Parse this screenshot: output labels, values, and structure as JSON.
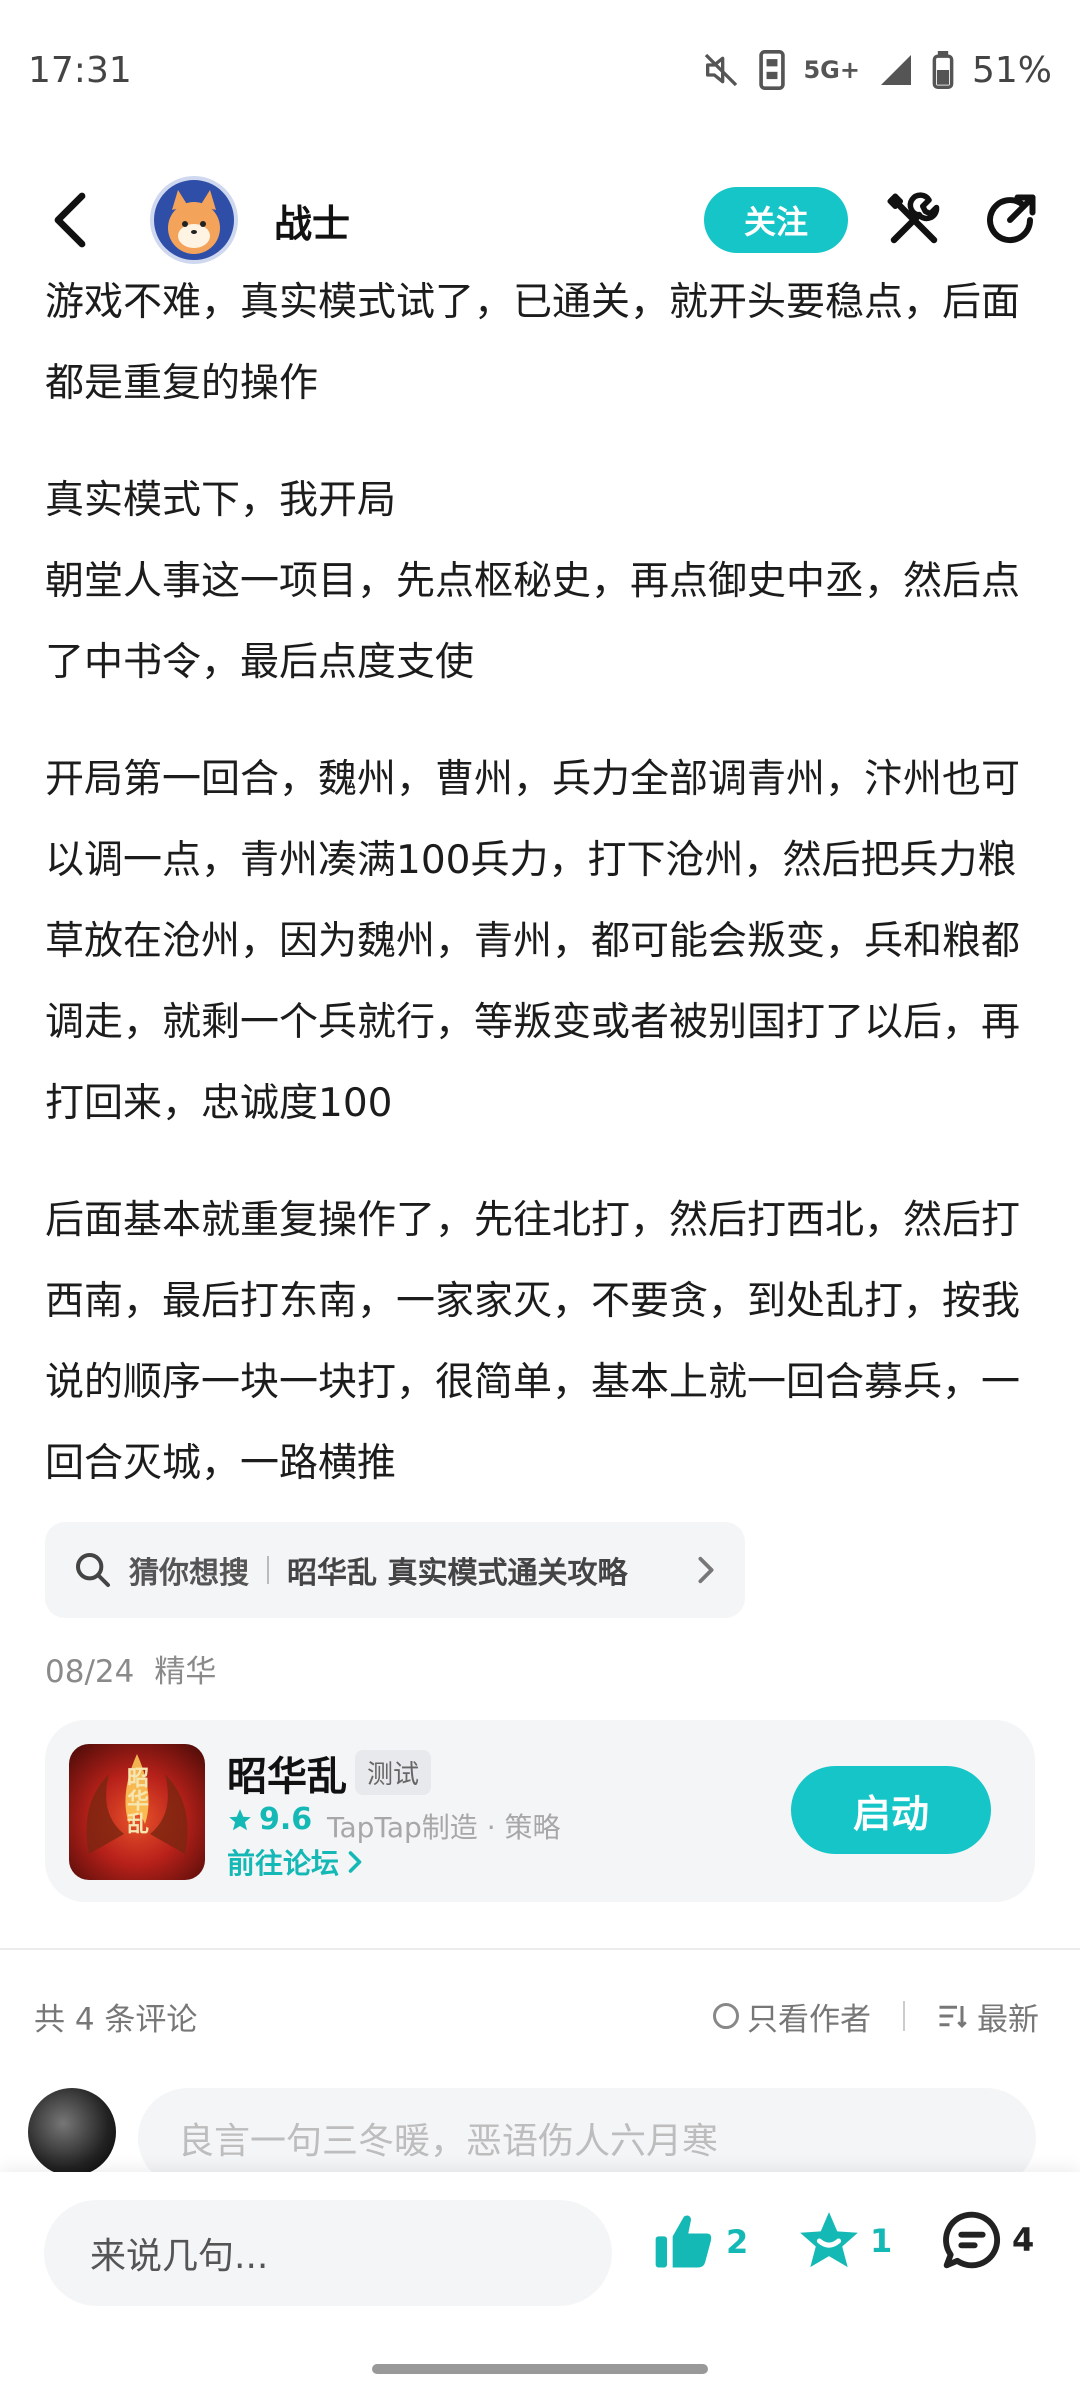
{
  "status_bar": {
    "time": "17:31",
    "network": "5G+",
    "battery": "51%",
    "icons": [
      "mute-icon",
      "signal-icon",
      "battery-icon"
    ]
  },
  "header": {
    "author": "战士",
    "follow_label": "关注",
    "icons": [
      "back-icon",
      "tools-icon",
      "share-icon"
    ]
  },
  "article": {
    "paragraphs": [
      "游戏不难，真实模式试了，已通关，就开头要稳点，后面都是重复的操作",
      "真实模式下，我开局\n朝堂人事这一项目，先点枢秘史，再点御史中丞，然后点了中书令，最后点度支使",
      "开局第一回合，魏州，曹州，兵力全部调青州，汴州也可以调一点，青州凑满100兵力，打下沧州，然后把兵力粮草放在沧州，因为魏州，青州，都可能会叛变，兵和粮都调走，就剩一个兵就行，等叛变或者被别国打了以后，再打回来，忠诚度100",
      "后面基本就重复操作了，先往北打，然后打西北，然后打西南，最后打东南，一家家灭，不要贪，到处乱打，按我说的顺序一块一块打，很简单，基本上就一回合募兵，一回合灭城，一路横推"
    ]
  },
  "search_suggest": {
    "label": "猜你想搜",
    "query": "昭华乱 真实模式通关攻略"
  },
  "meta": {
    "date": "08/24",
    "tag": "精华"
  },
  "game_card": {
    "logo_text": "昭华乱",
    "title": "昭华乱",
    "tag": "测试",
    "rating": "9.6",
    "maker": "TapTap制造 · 策略",
    "forum_link": "前往论坛",
    "launch_label": "启动"
  },
  "comments": {
    "count_text": "共 4 条评论",
    "only_author": "只看作者",
    "sort": "最新",
    "input_placeholder": "良言一句三冬暖，恶语伤人六月寒"
  },
  "bottom_bar": {
    "say_placeholder": "来说几句...",
    "likes": "2",
    "favorites": "1",
    "comments": "4"
  },
  "colors": {
    "accent": "#15c5c7",
    "accent_text": "#14b8b5"
  }
}
